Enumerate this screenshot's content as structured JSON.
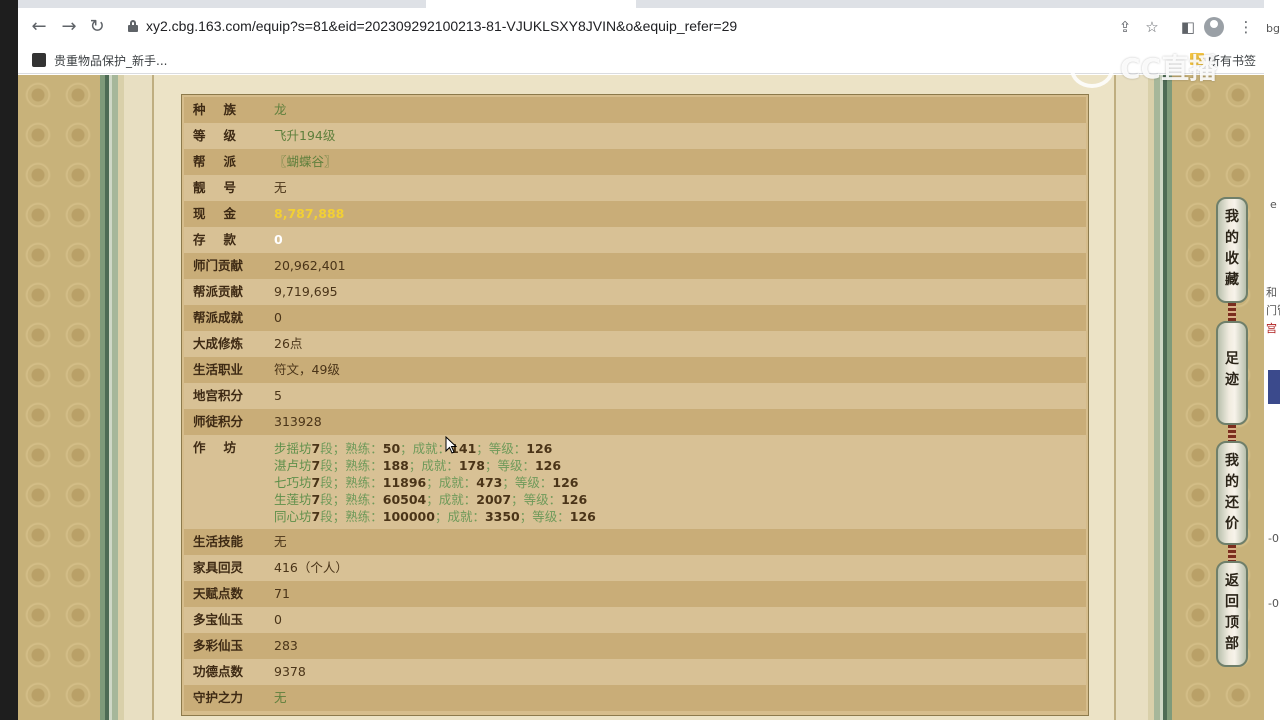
{
  "browser": {
    "url": "xy2.cbg.163.com/equip?s=81&eid=202309292100213-81-VJUKLSXY8JVIN&o&equip_refer=29",
    "nav": {
      "back_icon": "arrow-left-icon",
      "forward_icon": "arrow-right-icon",
      "reload_icon": "reload-icon"
    },
    "bookmark": {
      "label": "贵重物品保护_新手..."
    },
    "bookmark_folder": {
      "label": "所有书签"
    },
    "watermark": "CC直播"
  },
  "right_peek": {
    "t1": "bg",
    "t2": "e",
    "t3": "和",
    "t4": "门管",
    "t5": "宫",
    "t6": "-0",
    "t7": "-0"
  },
  "table": {
    "rows": [
      {
        "label": "种族",
        "value": "龙",
        "style": "green"
      },
      {
        "label": "等级",
        "value": "飞升194级",
        "style": "green"
      },
      {
        "label": "帮派",
        "value": "〖蝴蝶谷〗",
        "style": "green"
      },
      {
        "label": "靓号",
        "value": "无",
        "style": "dark"
      },
      {
        "label": "现金",
        "value": "8,787,888",
        "style": "gold"
      },
      {
        "label": "存款",
        "value": "0",
        "style": "white"
      },
      {
        "label": "师门贡献",
        "value": "20,962,401",
        "style": "dark"
      },
      {
        "label": "帮派贡献",
        "value": "9,719,695",
        "style": "dark"
      },
      {
        "label": "帮派成就",
        "value": "0",
        "style": "dark"
      },
      {
        "label": "大成修炼",
        "value": "26点",
        "style": "dark"
      },
      {
        "label": "生活职业",
        "value": "符文，49级",
        "style": "dark"
      },
      {
        "label": "地宫积分",
        "value": "5",
        "style": "dark"
      },
      {
        "label": "师徒积分",
        "value": "313928",
        "style": "dark"
      }
    ],
    "workshop": {
      "label": "作坊",
      "lines": [
        {
          "name": "步摇坊",
          "level": "7",
          "seg": "段；",
          "proficiency_label": "熟练：",
          "proficiency": "50",
          "achievement_label": "；成就：",
          "achievement": "141",
          "grade_label": "；等级：",
          "grade": "126"
        },
        {
          "name": "湛卢坊",
          "level": "7",
          "seg": "段；",
          "proficiency_label": "熟练：",
          "proficiency": "188",
          "achievement_label": "；成就：",
          "achievement": "178",
          "grade_label": "；等级：",
          "grade": "126"
        },
        {
          "name": "七巧坊",
          "level": "7",
          "seg": "段；",
          "proficiency_label": "熟练：",
          "proficiency": "11896",
          "achievement_label": "；成就：",
          "achievement": "473",
          "grade_label": "；等级：",
          "grade": "126"
        },
        {
          "name": "生莲坊",
          "level": "7",
          "seg": "段；",
          "proficiency_label": "熟练：",
          "proficiency": "60504",
          "achievement_label": "；成就：",
          "achievement": "2007",
          "grade_label": "；等级：",
          "grade": "126"
        },
        {
          "name": "同心坊",
          "level": "7",
          "seg": "段；",
          "proficiency_label": "熟练：",
          "proficiency": "100000",
          "achievement_label": "；成就：",
          "achievement": "3350",
          "grade_label": "；等级：",
          "grade": "126"
        }
      ]
    },
    "rows_after": [
      {
        "label": "生活技能",
        "value": "无",
        "style": "dark"
      },
      {
        "label": "家具回灵",
        "value": "416（个人）",
        "style": "dark"
      },
      {
        "label": "天赋点数",
        "value": "71",
        "style": "dark"
      },
      {
        "label": "多宝仙玉",
        "value": "0",
        "style": "dark"
      },
      {
        "label": "多彩仙玉",
        "value": "283",
        "style": "dark"
      },
      {
        "label": "功德点数",
        "value": "9378",
        "style": "dark"
      },
      {
        "label": "守护之力",
        "value": "无",
        "style": "green"
      }
    ]
  },
  "side_buttons": [
    {
      "chars": [
        "我",
        "的",
        "收",
        "藏"
      ]
    },
    {
      "chars": [
        "足",
        "迹"
      ]
    },
    {
      "chars": [
        "我",
        "的",
        "还",
        "价"
      ]
    },
    {
      "chars": [
        "返",
        "回",
        "顶",
        "部"
      ]
    }
  ],
  "colors": {
    "gold_value": "#f2d034",
    "green_value": "#5e7f3c",
    "label": "#3e2a14"
  }
}
